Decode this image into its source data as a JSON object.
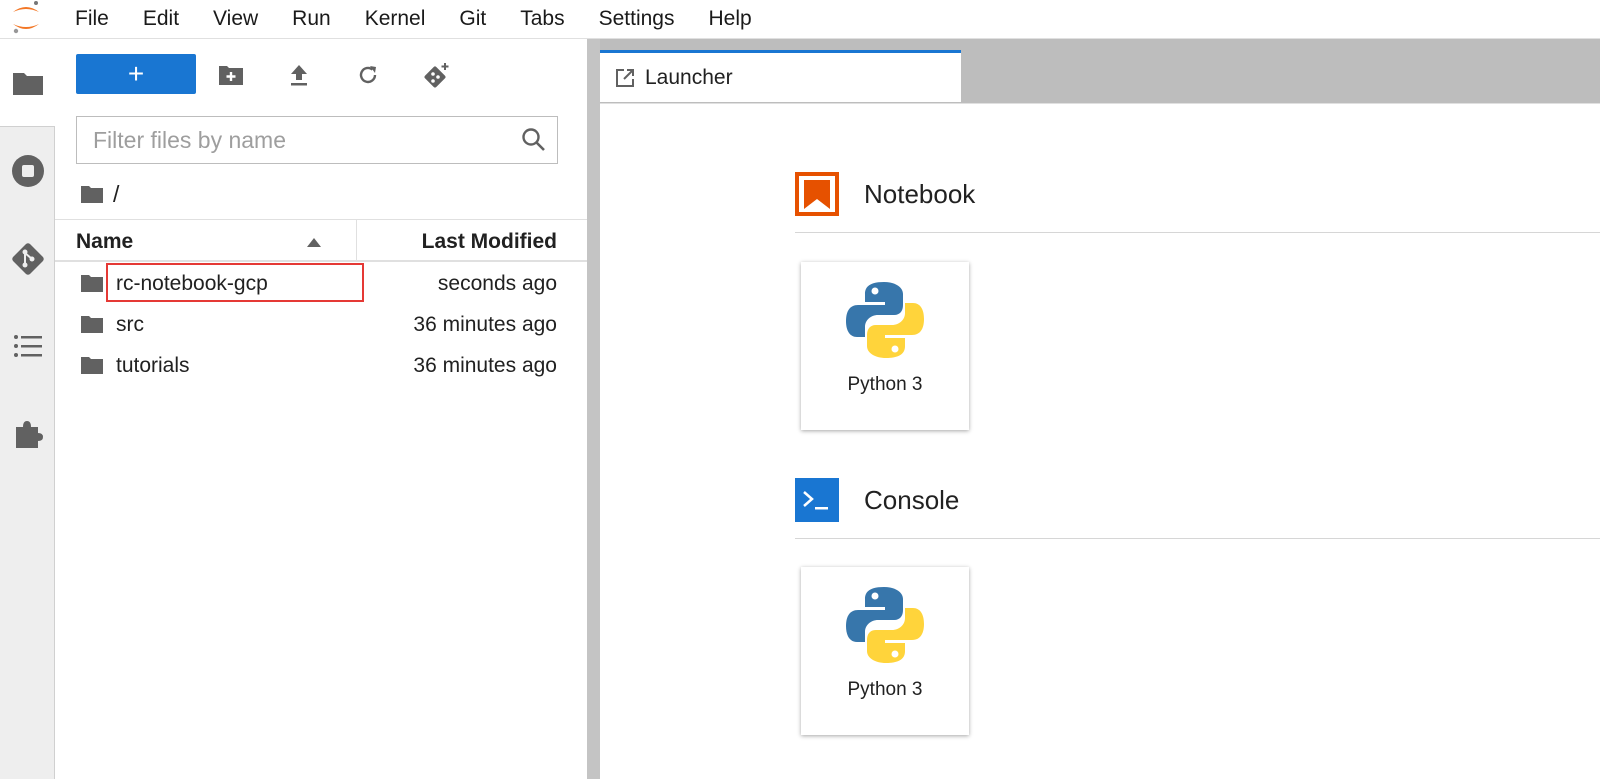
{
  "menu": [
    "File",
    "Edit",
    "View",
    "Run",
    "Kernel",
    "Git",
    "Tabs",
    "Settings",
    "Help"
  ],
  "toolbar": {
    "new_label": "+"
  },
  "filter": {
    "placeholder": "Filter files by name"
  },
  "breadcrumb": "/",
  "list": {
    "col_name": "Name",
    "col_modified": "Last Modified",
    "rows": [
      {
        "name": "rc-notebook-gcp",
        "modified": "seconds ago"
      },
      {
        "name": "src",
        "modified": "36 minutes ago"
      },
      {
        "name": "tutorials",
        "modified": "36 minutes ago"
      }
    ]
  },
  "tab": {
    "label": "Launcher"
  },
  "launcher": {
    "notebook": {
      "title": "Notebook",
      "card": "Python 3"
    },
    "console": {
      "title": "Console",
      "card": "Python 3"
    }
  },
  "colors": {
    "accent": "#1976d2",
    "notebook": "#e65100",
    "highlight": "#e53935"
  }
}
